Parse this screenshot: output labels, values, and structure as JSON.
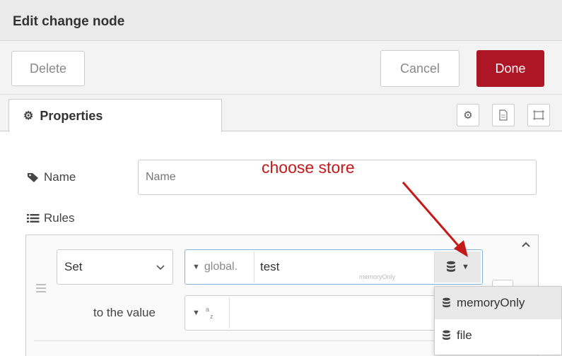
{
  "dialog": {
    "title": "Edit change node",
    "delete_label": "Delete",
    "cancel_label": "Cancel",
    "done_label": "Done",
    "accent_color": "#ad1625"
  },
  "tabs": {
    "properties_label": "Properties",
    "properties_icon": "gear-icon",
    "right_icons": [
      "gear-icon",
      "document-icon",
      "layout-icon"
    ]
  },
  "form": {
    "name_label": "Name",
    "name_placeholder": "Name",
    "name_value": "",
    "rules_label": "Rules"
  },
  "rule": {
    "action": "Set",
    "property_type": "global.",
    "property_value": "test",
    "store_label": "memoryOnly",
    "to_value_label": "to the value",
    "value_type_icon": "string-type-icon"
  },
  "store_dropdown": {
    "options": [
      "memoryOnly",
      "file"
    ],
    "highlighted": "memoryOnly"
  },
  "annotation": {
    "text": "choose store",
    "color": "#c41a1a"
  }
}
